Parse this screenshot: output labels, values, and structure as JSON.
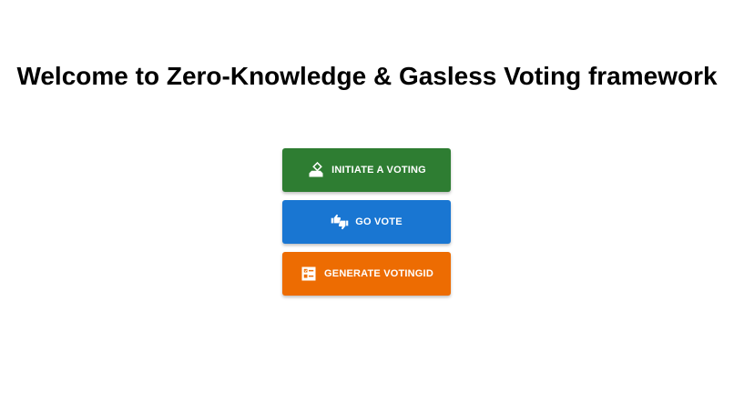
{
  "page": {
    "title": "Welcome to Zero-Knowledge & Gasless Voting framework"
  },
  "actions": [
    {
      "label": "INITIATE A VOTING",
      "icon": "ballot-box-icon",
      "color": "#2e7d32"
    },
    {
      "label": "GO VOTE",
      "icon": "thumbs-up-down-icon",
      "color": "#1976d2"
    },
    {
      "label": "GENERATE VOTINGID",
      "icon": "checklist-icon",
      "color": "#ed6c02"
    }
  ]
}
